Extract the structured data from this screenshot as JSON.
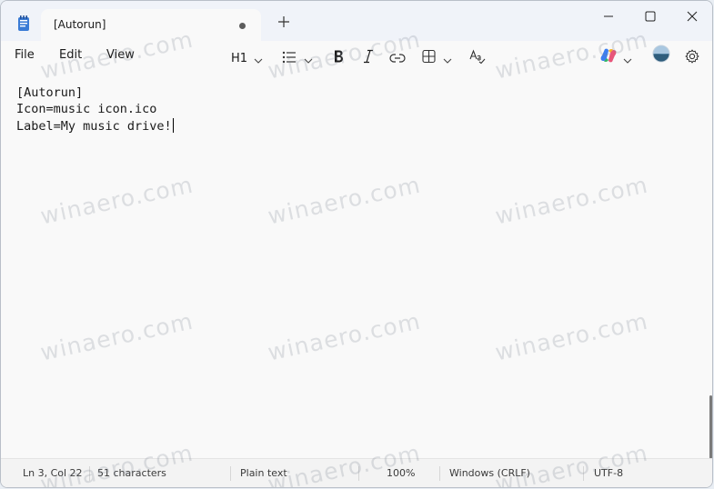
{
  "tab": {
    "title": "[Autorun]"
  },
  "menu": {
    "file": "File",
    "edit": "Edit",
    "view": "View"
  },
  "toolbar": {
    "heading": "H1"
  },
  "editor": {
    "lines": [
      "[Autorun]",
      "Icon=music icon.ico",
      "Label=My music drive!"
    ]
  },
  "status": {
    "position": "Ln 3, Col 22",
    "characters": "51 characters",
    "format": "Plain text",
    "zoom": "100%",
    "line_ending": "Windows (CRLF)",
    "encoding": "UTF-8"
  },
  "watermark": "winaero.com",
  "colors": {
    "accent": "#0067c0",
    "background": "#f9f9f9"
  }
}
